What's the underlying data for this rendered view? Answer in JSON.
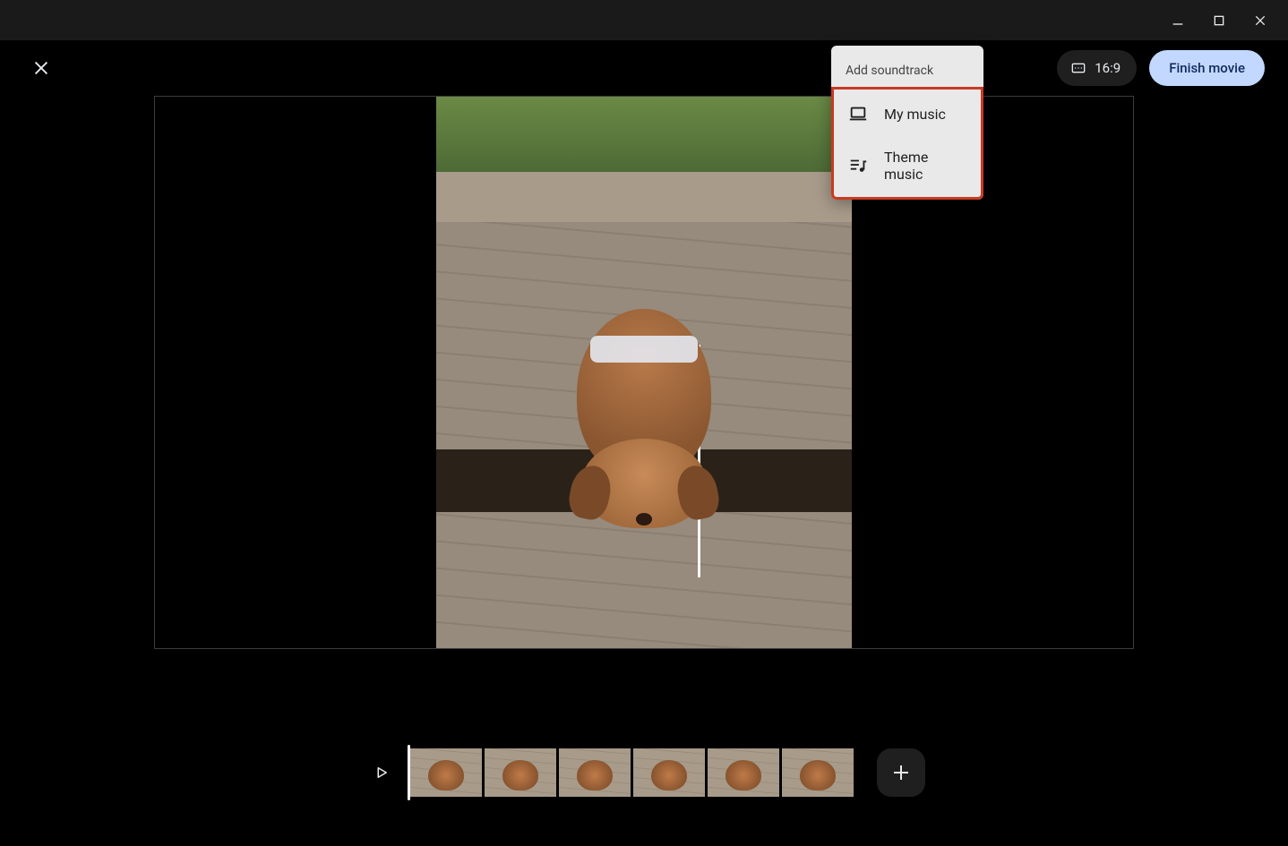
{
  "toolbar": {
    "aspect_label": "16:9",
    "finish_label": "Finish movie"
  },
  "soundtrack_menu": {
    "title": "Add soundtrack",
    "my_music_label": "My music",
    "theme_music_label": "Theme music"
  },
  "timeline": {
    "clip_count": 6
  }
}
